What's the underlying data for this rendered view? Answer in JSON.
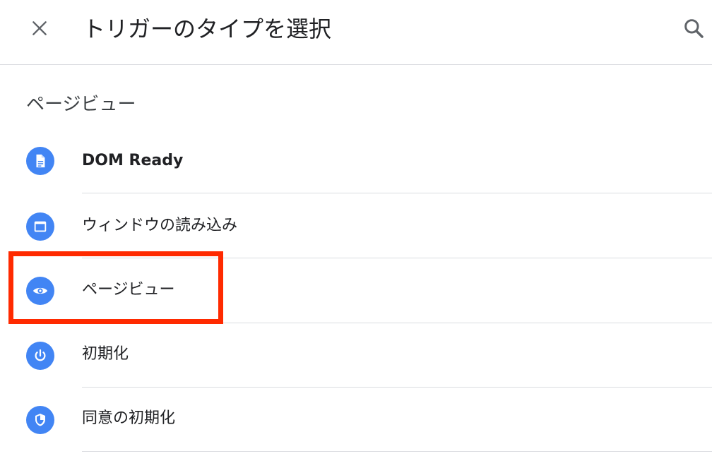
{
  "header": {
    "title": "トリガーのタイプを選択",
    "close_icon": "close-icon",
    "search_icon": "search-icon"
  },
  "section": {
    "title": "ページビュー"
  },
  "items": [
    {
      "label": "DOM Ready",
      "icon": "document-icon"
    },
    {
      "label": "ウィンドウの読み込み",
      "icon": "window-icon"
    },
    {
      "label": "ページビュー",
      "icon": "eye-icon"
    },
    {
      "label": "初期化",
      "icon": "power-icon"
    },
    {
      "label": "同意の初期化",
      "icon": "shield-icon"
    }
  ],
  "colors": {
    "icon_bg": "#4285f4",
    "highlight": "#ff2a00",
    "divider": "#dadce0"
  }
}
